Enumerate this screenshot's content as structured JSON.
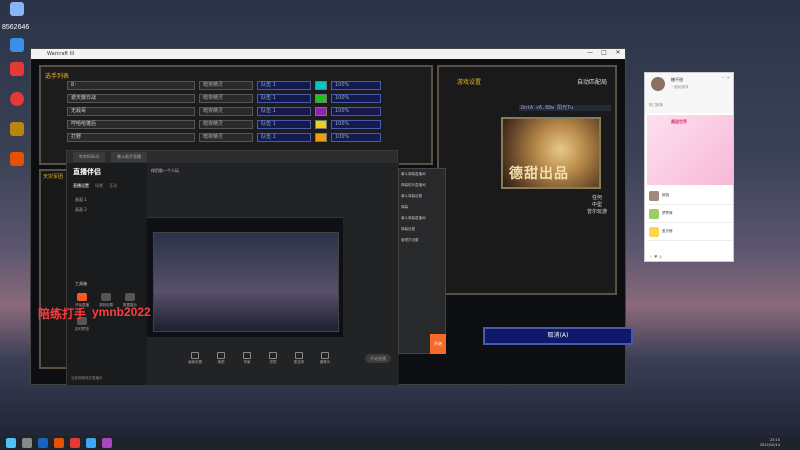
{
  "desktop": {
    "user_id": "8562646",
    "icons": [
      {
        "label": "",
        "color": "#3a8fe8"
      },
      {
        "label": "",
        "color": "#e53935"
      },
      {
        "label": "",
        "color": "#e53935"
      },
      {
        "label": "",
        "color": "#b8860b"
      },
      {
        "label": "",
        "color": "#e65100"
      }
    ]
  },
  "game": {
    "window_title": "Warcraft III",
    "lobby_title": "选手列表",
    "players": [
      {
        "name": "8·",
        "state": "暗夜精灵",
        "team": "队伍 1",
        "color": "#00c8c8",
        "hand": "100%"
      },
      {
        "name": "遮天蔽日战",
        "state": "暗夜精灵",
        "team": "队伍 1",
        "color": "#18c818",
        "hand": "100%"
      },
      {
        "name": "无敌哥",
        "state": "暗夜精灵",
        "team": "队伍 1",
        "color": "#8e24aa",
        "hand": "100%"
      },
      {
        "name": "哼哈哈蓬后",
        "state": "暗夜精灵",
        "team": "队伍 1",
        "color": "#e6d020",
        "hand": "100%"
      },
      {
        "name": "打野",
        "state": "暗夜精灵",
        "team": "队伍 1",
        "color": "#f39c12",
        "hand": "100%"
      }
    ],
    "game_setting_label": "游戏设置",
    "auto_match_label": "自动匹配局",
    "map_name": "DotA v6.88w 阳光Tu",
    "map_caption": "德甜出品",
    "map_info": [
      "任何",
      "中型",
      "曾尔玩游"
    ],
    "chat_title": "天灾军团",
    "leave_button": "取消(A)"
  },
  "stream_app": {
    "tabs": [
      "哔哔Bilibili",
      "暴斗助手直播"
    ],
    "logo": "直播伴侣",
    "side_tabs": [
      "直播设置",
      "场景",
      "互动"
    ],
    "scenes": [
      "画面 1",
      "画面 2"
    ],
    "tools_label": "工具箱",
    "tools": [
      "开始直播",
      "录制设置",
      "数据展示",
      "实时预览"
    ],
    "head_title": "伴侣助一个人玩",
    "bottom_tools": [
      "画面设置",
      "美颜",
      "背景",
      "滤镜",
      "麦克风",
      "摄像头"
    ],
    "live_button": "开始直播",
    "status_text": "当前网络良好直播中",
    "dropdown_items": [
      "暴斗弹幕直播间",
      "弹幕助手直播间",
      "暴斗弹幕设置",
      "弹幕",
      "暴斗弹幕直播间",
      "弹幕设置",
      "管理员设置"
    ],
    "orange_button": "开始"
  },
  "watermark": {
    "left": "陪练打手",
    "right": "ymnb2022"
  },
  "right_panel": {
    "name": "糖不甜",
    "sub": "一起玩游戏",
    "tabs": "热门推荐",
    "banner": "邂逅世界",
    "items": [
      "桃桃",
      "梦梦熊",
      "宝贝熊"
    ],
    "footer": "☆ ♥ ◎"
  },
  "taskbar": {
    "time": "23:15",
    "date": "2022/10/14"
  }
}
